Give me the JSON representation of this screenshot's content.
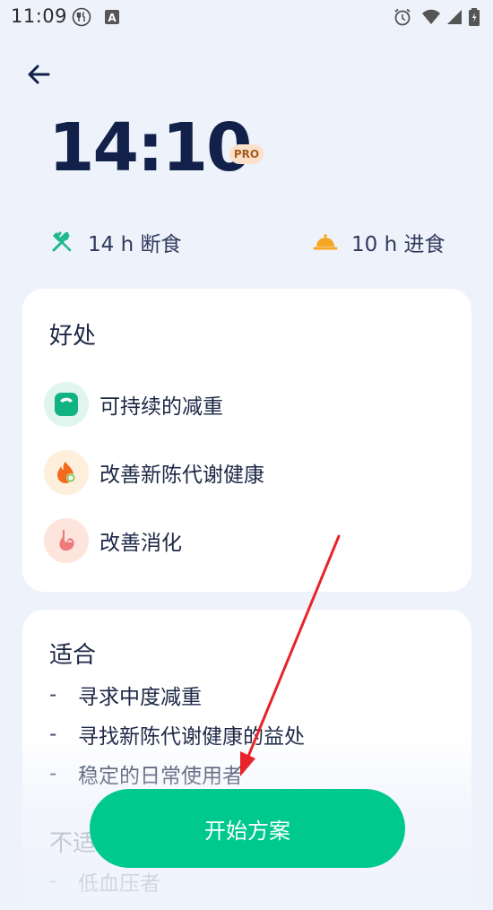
{
  "status_bar": {
    "time": "11:09",
    "icons": [
      "fork-knife-icon",
      "a-box-icon",
      "alarm-icon",
      "wifi-icon",
      "signal-icon",
      "battery-icon"
    ]
  },
  "header": {
    "plan_name": "14:10",
    "badge": "PRO",
    "fast_label": "14 h 断食",
    "eat_label": "10 h 进食"
  },
  "benefits": {
    "title": "好处",
    "items": [
      {
        "label": "可持续的减重",
        "icon": "scale-icon"
      },
      {
        "label": "改善新陈代谢健康",
        "icon": "flame-icon"
      },
      {
        "label": "改善消化",
        "icon": "stomach-icon"
      }
    ]
  },
  "fit": {
    "title": "适合",
    "items": [
      {
        "dash": "-",
        "label": "寻求中度减重"
      },
      {
        "dash": "-",
        "label": "寻找新陈代谢健康的益处"
      },
      {
        "dash": "-",
        "label": "稳定的日常使用者"
      }
    ],
    "unfit_title": "不适",
    "unfit_items": [
      {
        "dash": "-",
        "label": "低血压者"
      }
    ]
  },
  "cta": {
    "label": "开始方案"
  },
  "colors": {
    "accent": "#00c98d",
    "background": "#eef2fb",
    "annotation_arrow": "#e8232a"
  }
}
